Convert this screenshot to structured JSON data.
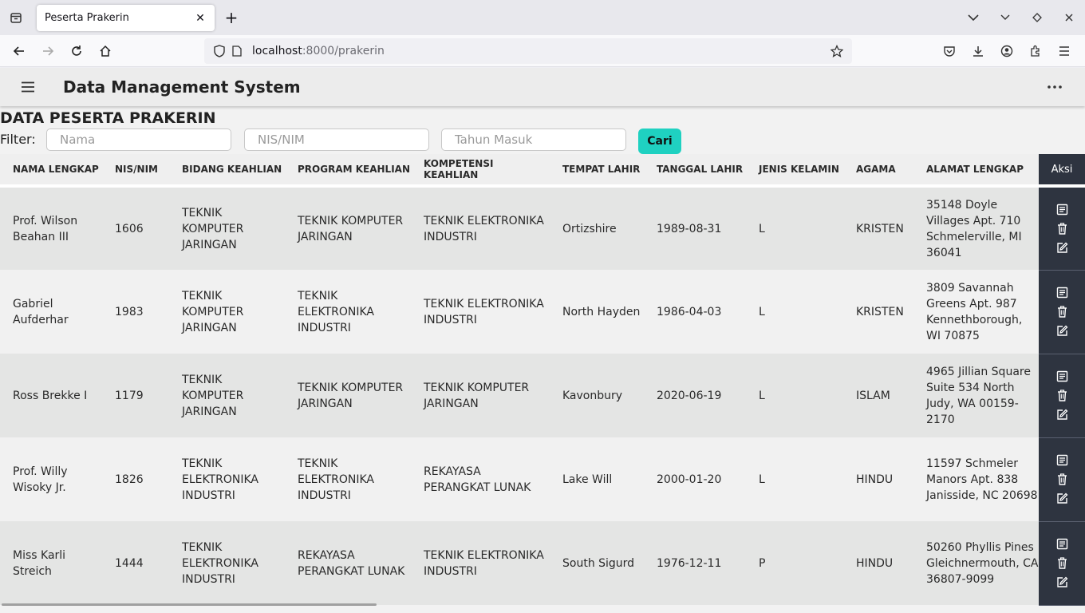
{
  "browser": {
    "tab_title": "Peserta Prakerin",
    "url_host": "localhost",
    "url_path": ":8000/prakerin"
  },
  "app": {
    "title": "Data Management System"
  },
  "page": {
    "heading": "DATA PESERTA PRAKERIN",
    "filter_label": "Filter:",
    "filter_nama_placeholder": "Nama",
    "filter_nis_placeholder": "NIS/NIM",
    "filter_tahun_placeholder": "Tahun Masuk",
    "search_button": "Cari"
  },
  "table": {
    "headers": [
      "NAMA LENGKAP",
      "NIS/NIM",
      "BIDANG KEAHLIAN",
      "PROGRAM KEAHLIAN",
      "KOMPETENSI KEAHLIAN",
      "TEMPAT LAHIR",
      "TANGGAL LAHIR",
      "JENIS KELAMIN",
      "AGAMA",
      "ALAMAT LENGKAP",
      "Aksi"
    ],
    "rows": [
      [
        "Prof. Wilson Beahan III",
        "1606",
        "TEKNIK KOMPUTER JARINGAN",
        "TEKNIK KOMPUTER JARINGAN",
        "TEKNIK ELEKTRONIKA INDUSTRI",
        "Ortizshire",
        "1989-08-31",
        "L",
        "KRISTEN",
        "35148 Doyle Villages Apt. 710 Schmelerville, MI 36041"
      ],
      [
        "Gabriel Aufderhar",
        "1983",
        "TEKNIK KOMPUTER JARINGAN",
        "TEKNIK ELEKTRONIKA INDUSTRI",
        "TEKNIK ELEKTRONIKA INDUSTRI",
        "North Hayden",
        "1986-04-03",
        "L",
        "KRISTEN",
        "3809 Savannah Greens Apt. 987 Kennethborough, WI 70875"
      ],
      [
        "Ross Brekke I",
        "1179",
        "TEKNIK KOMPUTER JARINGAN",
        "TEKNIK KOMPUTER JARINGAN",
        "TEKNIK KOMPUTER JARINGAN",
        "Kavonbury",
        "2020-06-19",
        "L",
        "ISLAM",
        "4965 Jillian Square Suite 534 North Judy, WA 00159-2170"
      ],
      [
        "Prof. Willy Wisoky Jr.",
        "1826",
        "TEKNIK ELEKTRONIKA INDUSTRI",
        "TEKNIK ELEKTRONIKA INDUSTRI",
        "REKAYASA PERANGKAT LUNAK",
        "Lake Will",
        "2000-01-20",
        "L",
        "HINDU",
        "11597 Schmeler Manors Apt. 838 Janisside, NC 20698"
      ],
      [
        "Miss Karli Streich",
        "1444",
        "TEKNIK ELEKTRONIKA INDUSTRI",
        "REKAYASA PERANGKAT LUNAK",
        "TEKNIK ELEKTRONIKA INDUSTRI",
        "South Sigurd",
        "1976-12-11",
        "P",
        "HINDU",
        "50260 Phyllis Pines Gleichnermouth, CA 36807-9099"
      ]
    ]
  }
}
